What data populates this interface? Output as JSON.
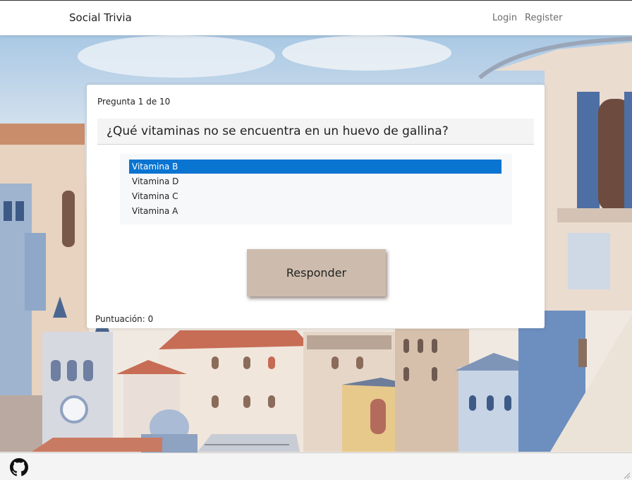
{
  "navbar": {
    "brand": "Social Trivia",
    "login_label": "Login",
    "register_label": "Register"
  },
  "quiz": {
    "counter": "Pregunta 1 de 10",
    "question": "¿Qué vitaminas no se encuentra en un huevo de gallina?",
    "options": [
      "Vitamina B",
      "Vitamina D",
      "Vitamina C",
      "Vitamina A"
    ],
    "selected_option": "Vitamina B",
    "submit_label": "Responder",
    "score": "Puntuación: 0"
  },
  "footer": {
    "icon": "github-icon"
  },
  "colors": {
    "selected": "#0a74d1",
    "button": "#cdbcad"
  }
}
